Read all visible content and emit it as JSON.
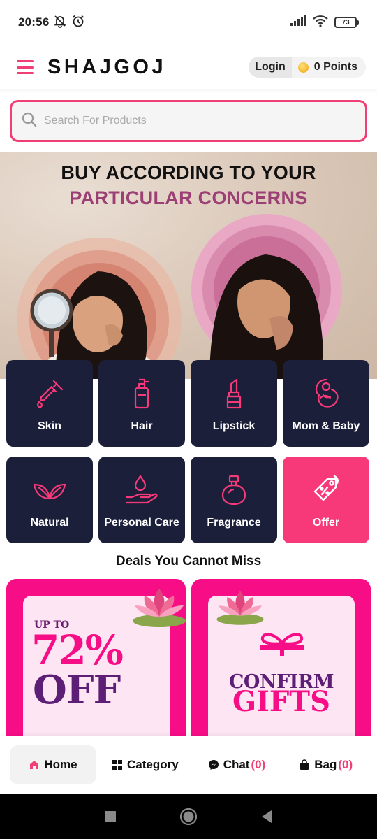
{
  "status_bar": {
    "time": "20:56",
    "battery": "73"
  },
  "header": {
    "brand": "SHAJGOJ",
    "login_label": "Login",
    "points_label": "0 Points"
  },
  "search": {
    "placeholder": "Search For Products"
  },
  "banner": {
    "line1": "BUY ACCORDING TO YOUR",
    "line2": "PARTICULAR CONCERNS"
  },
  "categories": [
    {
      "label": "Skin",
      "icon": "dropper-icon"
    },
    {
      "label": "Hair",
      "icon": "pump-bottle-icon"
    },
    {
      "label": "Lipstick",
      "icon": "lipstick-icon"
    },
    {
      "label": "Mom & Baby",
      "icon": "mom-baby-icon"
    },
    {
      "label": "Natural",
      "icon": "leaves-icon"
    },
    {
      "label": "Personal Care",
      "icon": "hand-drop-icon"
    },
    {
      "label": "Fragrance",
      "icon": "perfume-icon"
    },
    {
      "label": "Offer",
      "icon": "price-tag-icon"
    }
  ],
  "deals": {
    "title": "Deals You Cannot Miss",
    "card1": {
      "upto": "UP TO",
      "percent": "72%",
      "off": "OFF"
    },
    "card2": {
      "line1": "CONFIRM",
      "line2": "GIFTS"
    }
  },
  "bottom_nav": {
    "home": "Home",
    "category": "Category",
    "chat": "Chat",
    "chat_count": "(0)",
    "bag": "Bag",
    "bag_count": "(0)"
  },
  "colors": {
    "accent": "#ef3f74",
    "tile": "#1c1f3a",
    "deal_pink": "#f70d86",
    "deal_purple": "#5c1f75"
  }
}
